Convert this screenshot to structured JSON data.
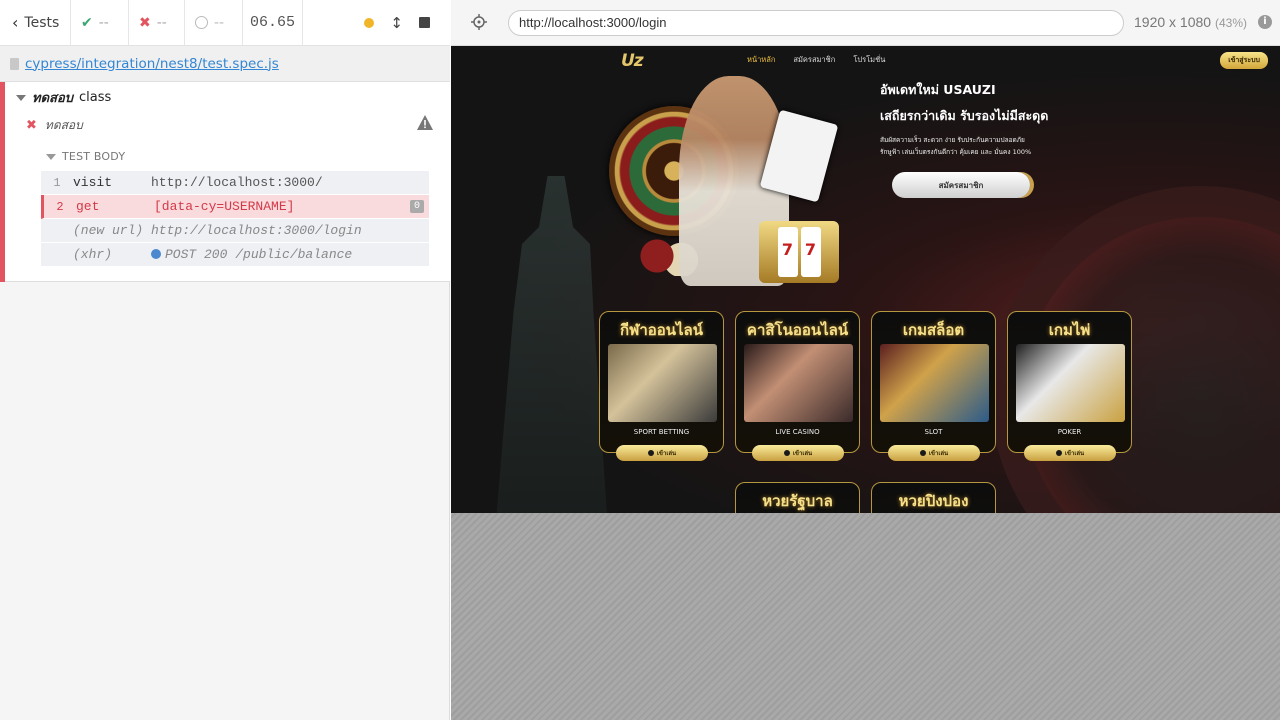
{
  "runner": {
    "back_label": "Tests",
    "passed": "--",
    "failed": "--",
    "pending": "--",
    "duration": "06.65",
    "spec_path": "cypress/integration/nest8/test.spec.js",
    "suite_title_italic": "ทดสอบ",
    "suite_title_rest": "class",
    "test_title": "ทดสอบ",
    "test_body_label": "TEST BODY",
    "commands": [
      {
        "num": "1",
        "name": "visit",
        "message": "http://localhost:3000/"
      },
      {
        "num": "2",
        "name": "get",
        "message": "[data-cy=USERNAME]",
        "badge": "0"
      },
      {
        "num": "",
        "name": "(new url)",
        "message": "http://localhost:3000/login"
      },
      {
        "num": "",
        "name": "(xhr)",
        "message": "POST 200 /public/balance"
      }
    ]
  },
  "browser": {
    "url": "http://localhost:3000/login",
    "viewport": "1920 x 1080",
    "zoom": "(43%)"
  },
  "site": {
    "logo": "Uz",
    "nav": [
      "หน้าหลัก",
      "สมัครสมาชิก",
      "โปรโมชั่น"
    ],
    "login_button": "เข้าสู่ระบบ",
    "hero_title": "อัพเดทใหม่ USAUZI",
    "hero_subtitle": "เสถียรกว่าเดิม รับรองไม่มีสะดุด",
    "hero_line1": "สัมผัสความเร็ว สะดวก ง่าย รับประกันความปลอดภัย",
    "hero_line2": "รักษูฟ้า เล่นเว็บตรงกันดีกว่า คุ้มเคย และ มั่นคง 100%",
    "register_button": "สมัครสมาชิก",
    "play_label": "เข้าเล่น",
    "categories": [
      {
        "title": "กีฬาออนไลน์",
        "label": "SPORT BETTING"
      },
      {
        "title": "คาสิโนออนไลน์",
        "label": "LIVE CASINO"
      },
      {
        "title": "เกมสล็อต",
        "label": "SLOT"
      },
      {
        "title": "เกมไพ่",
        "label": "POKER"
      },
      {
        "title": "หวยรัฐบาล",
        "label": ""
      },
      {
        "title": "หวยปิงปอง",
        "label": ""
      }
    ],
    "slot_reels": [
      "7",
      "7"
    ]
  },
  "colors": {
    "fail_red": "#e2545f",
    "link_blue": "#3386d4",
    "gold": "#e4c66b",
    "running_dot": "#f0b529"
  }
}
